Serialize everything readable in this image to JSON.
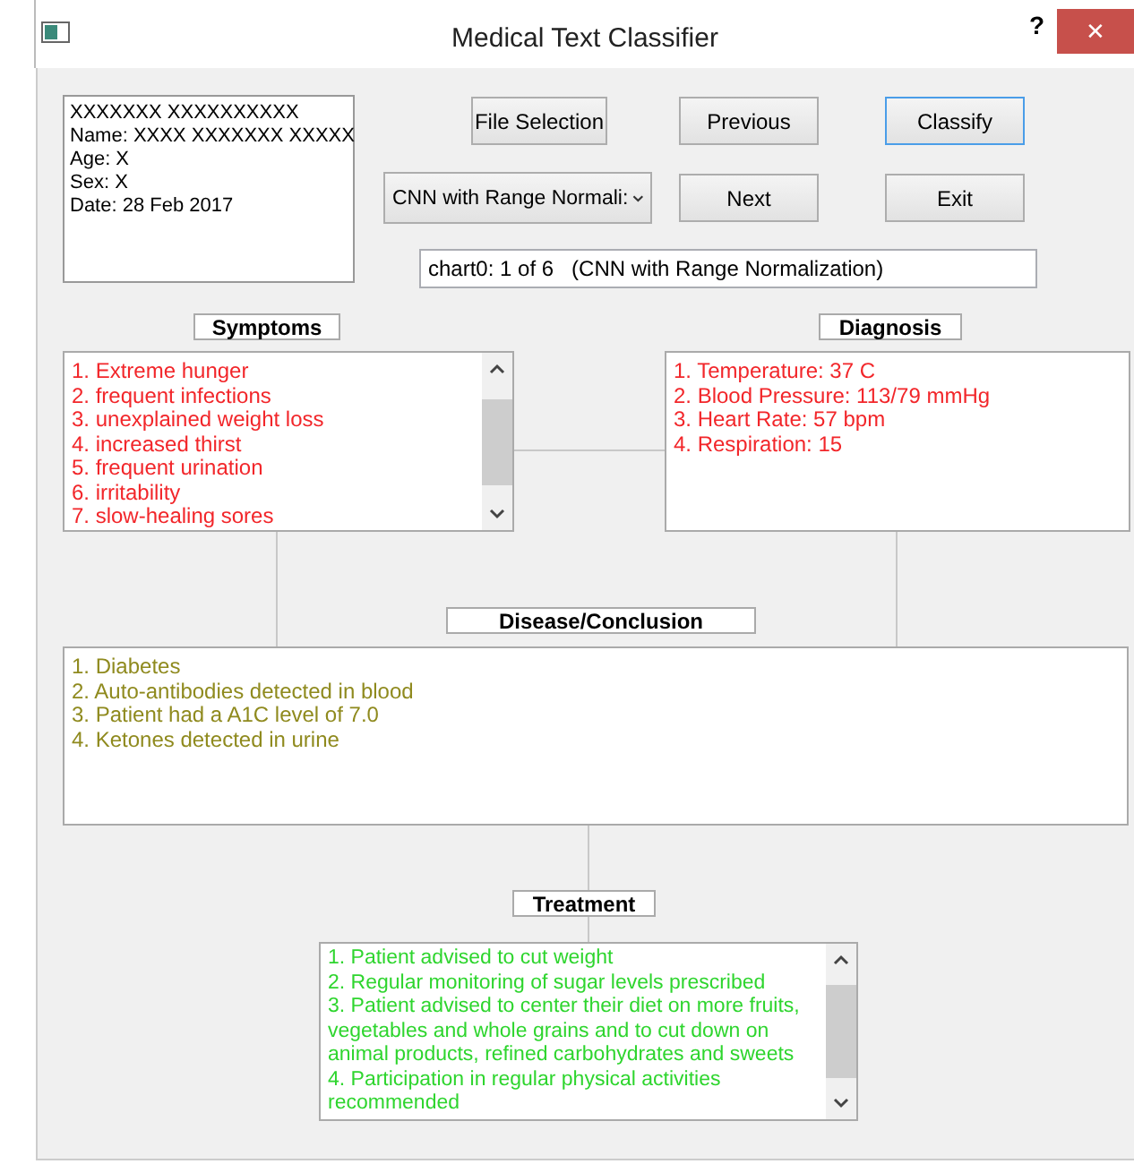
{
  "window": {
    "title": "Medical Text Classifier",
    "help": "?",
    "close": "✕"
  },
  "patient_info": [
    "XXXXXXX XXXXXXXXXX",
    "Name: XXXX XXXXXXX XXXXX",
    "Age: X",
    "Sex: X",
    "Date: 28 Feb 2017"
  ],
  "buttons": [
    {
      "label": "File Selection",
      "focused": false
    },
    {
      "label": "Previous",
      "focused": false
    },
    {
      "label": "Classify",
      "focused": true
    },
    {
      "label": "Next",
      "focused": false
    },
    {
      "label": "Exit",
      "focused": false
    }
  ],
  "model_dropdown": {
    "value": "CNN with Range Normali:"
  },
  "status_field": {
    "value": "chart0: 1 of 6   (CNN with Range Normalization)"
  },
  "symptoms": {
    "title": "Symptoms",
    "items": [
      "1. Extreme hunger",
      "2. frequent infections",
      "3. unexplained weight loss",
      "4. increased thirst",
      "5. frequent urination",
      "6. irritability",
      "7. slow-healing sores"
    ]
  },
  "diagnosis": {
    "title": "Diagnosis",
    "items": [
      "1. Temperature: 37 C",
      "2. Blood Pressure: 113/79 mmHg",
      "3. Heart Rate: 57 bpm",
      "4. Respiration: 15"
    ]
  },
  "conclusion": {
    "title": "Disease/Conclusion",
    "items": [
      "1. Diabetes",
      "2. Auto-antibodies detected in blood",
      "3. Patient had a A1C level of 7.0",
      "4. Ketones detected in urine"
    ]
  },
  "treatment": {
    "title": "Treatment",
    "items": [
      "1. Patient advised to cut weight",
      "2. Regular monitoring of sugar levels prescribed",
      "3. Patient advised to center their diet on more fruits, vegetables and whole grains and to cut down on animal products, refined carbohydrates and sweets",
      "4. Participation in regular physical activities recommended"
    ]
  }
}
